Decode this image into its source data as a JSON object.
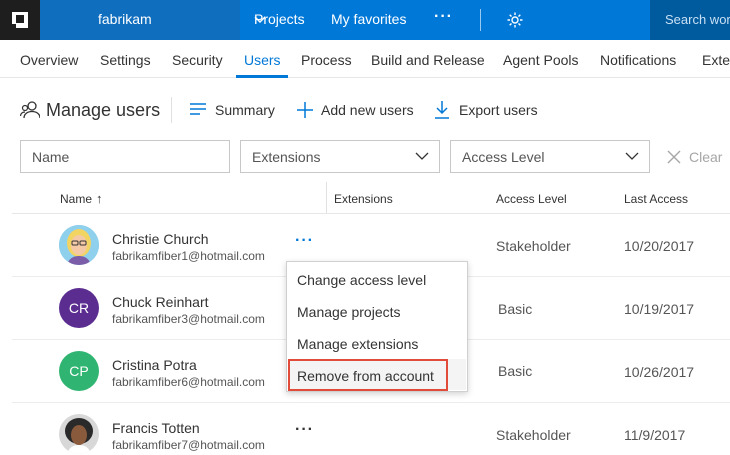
{
  "topbar": {
    "account_name": "fabrikam",
    "nav": [
      "Projects",
      "My favorites"
    ],
    "more": "···",
    "search_placeholder": "Search wor"
  },
  "tabs": [
    "Overview",
    "Settings",
    "Security",
    "Users",
    "Process",
    "Build and Release",
    "Agent Pools",
    "Notifications",
    "Exter"
  ],
  "active_tab": "Users",
  "toolbar": {
    "title": "Manage users",
    "summary": "Summary",
    "add": "Add new users",
    "export": "Export users"
  },
  "filters": {
    "name_placeholder": "Name",
    "extensions": "Extensions",
    "access_level": "Access Level",
    "clear": "Clear"
  },
  "table": {
    "columns": [
      "Name",
      "Extensions",
      "Access Level",
      "Last Access"
    ],
    "sort_indicator": "↑",
    "rows": [
      {
        "name": "Christie Church",
        "email": "fabrikamfiber1@hotmail.com",
        "access": "Stakeholder",
        "last": "10/20/2017",
        "avatar": "photo",
        "dots": "···"
      },
      {
        "name": "Chuck Reinhart",
        "email": "fabrikamfiber3@hotmail.com",
        "access": "Basic",
        "last": "10/19/2017",
        "initials": "CR"
      },
      {
        "name": "Cristina Potra",
        "email": "fabrikamfiber6@hotmail.com",
        "access": "Basic",
        "last": "10/26/2017",
        "initials": "CP"
      },
      {
        "name": "Francis Totten",
        "email": "fabrikamfiber7@hotmail.com",
        "access": "Stakeholder",
        "last": "11/9/2017",
        "avatar": "photo",
        "dots": "···"
      }
    ]
  },
  "context_menu": [
    "Change access level",
    "Manage projects",
    "Manage extensions",
    "Remove from account"
  ],
  "colors": {
    "accent": "#0078d7",
    "cr_avatar": "#5c2d91",
    "cp_avatar": "#2fb571",
    "highlight": "#e04b3a"
  }
}
